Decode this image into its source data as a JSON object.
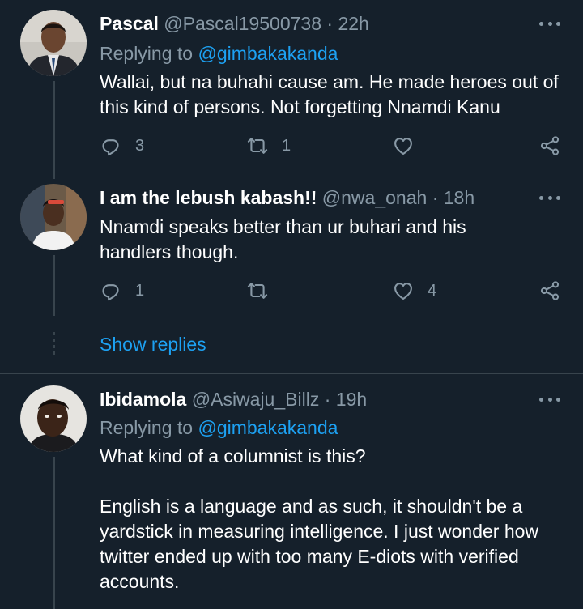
{
  "tweets": [
    {
      "name": "Pascal",
      "handle": "@Pascal19500738",
      "sep": "·",
      "time": "22h",
      "replying_label": "Replying to",
      "replying_to": "@gimbakakanda",
      "text": "Wallai, but na buhahi cause am. He made heroes out of this kind of persons. Not forgetting Nnamdi Kanu",
      "replies": "3",
      "retweets": "1",
      "likes": ""
    },
    {
      "name": "I am the lebush kabash!!",
      "handle": "@nwa_onah",
      "sep": "·",
      "time": "18h",
      "text": "Nnamdi speaks better than ur buhari and his handlers though.",
      "replies": "1",
      "retweets": "",
      "likes": "4"
    },
    {
      "name": "Ibidamola",
      "handle": "@Asiwaju_Billz",
      "sep": "·",
      "time": "19h",
      "replying_label": "Replying to",
      "replying_to": "@gimbakakanda",
      "text_p1": "What kind of a columnist is this?",
      "text_p2": "English is a language and as such, it shouldn't be a yardstick in measuring intelligence. I just wonder how twitter ended up with too many E-diots with verified accounts."
    }
  ],
  "show_replies": "Show replies",
  "colors": {
    "background": "#15202b",
    "text": "#ffffff",
    "muted": "#8899a6",
    "link": "#1da1f2",
    "line": "#38444d"
  },
  "icons": [
    "reply-icon",
    "retweet-icon",
    "like-icon",
    "share-icon",
    "more-icon"
  ]
}
